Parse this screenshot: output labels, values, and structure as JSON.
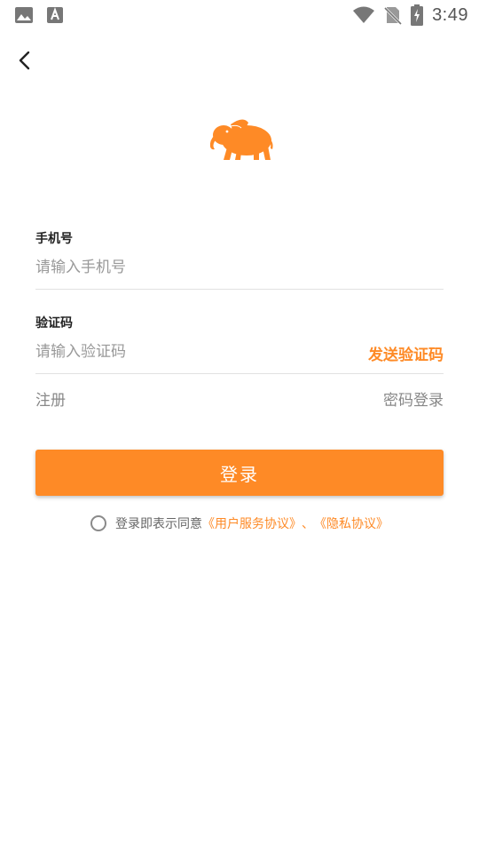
{
  "status_bar": {
    "time": "3:49",
    "icons": [
      "image-icon",
      "font-icon",
      "wifi-icon",
      "no-sim-icon",
      "battery-charging-icon"
    ]
  },
  "nav": {
    "back_icon": "chevron-left-icon"
  },
  "logo": {
    "icon": "elephant-logo-icon",
    "color": "#fe8a26"
  },
  "form": {
    "phone": {
      "label": "手机号",
      "placeholder": "请输入手机号",
      "value": ""
    },
    "code": {
      "label": "验证码",
      "placeholder": "请输入验证码",
      "value": "",
      "send_label": "发送验证码"
    },
    "register_label": "注册",
    "password_login_label": "密码登录"
  },
  "login_button": {
    "label": "登录"
  },
  "agreement": {
    "checked": false,
    "prefix": "登录即表示同意",
    "user_agreement": "《用户服务协议》",
    "separator": "、",
    "privacy_policy": "《隐私协议》"
  },
  "colors": {
    "accent": "#fe8a26",
    "placeholder": "#999999",
    "divider": "#e2e2e2"
  }
}
